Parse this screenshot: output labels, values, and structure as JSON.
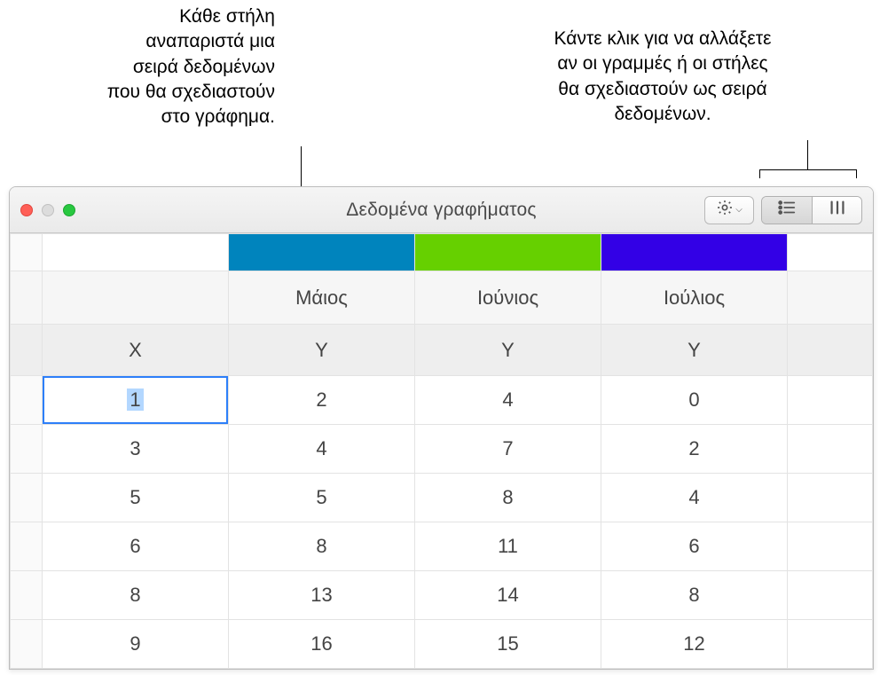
{
  "callouts": {
    "left": "Κάθε στήλη\nαναπαριστά μια\nσειρά δεδομένων\nπου θα σχεδιαστούν\nστο γράφημα.",
    "right": "Κάντε κλικ για να αλλάξετε\nαν οι γραμμές ή οι στήλες\nθα σχεδιαστούν ως σειρά\nδεδομένων."
  },
  "window": {
    "title": "Δεδομένα γραφήματος"
  },
  "series": {
    "colors": [
      "#0084bd",
      "#66d000",
      "#3300e6"
    ],
    "months": [
      "Μάιος",
      "Ιούνιος",
      "Ιούλιος"
    ]
  },
  "axis_labels": [
    "X",
    "Y",
    "Y",
    "Y"
  ],
  "chart_data": {
    "type": "table",
    "columns": [
      "X",
      "Μάιος",
      "Ιούνιος",
      "Ιούλιος"
    ],
    "rows": [
      [
        1,
        2,
        4,
        0
      ],
      [
        3,
        4,
        7,
        2
      ],
      [
        5,
        5,
        8,
        4
      ],
      [
        6,
        8,
        11,
        6
      ],
      [
        8,
        13,
        14,
        8
      ],
      [
        9,
        16,
        15,
        12
      ]
    ]
  }
}
